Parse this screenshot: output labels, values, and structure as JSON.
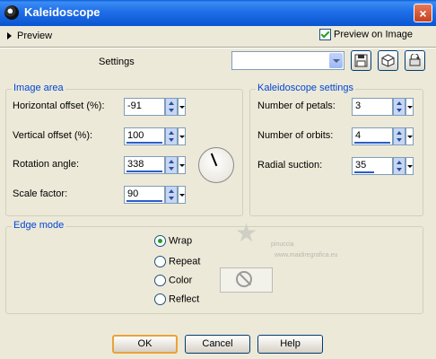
{
  "window": {
    "title": "Kaleidoscope",
    "close_glyph": "×"
  },
  "preview": {
    "label": "Preview",
    "preview_on_image_label": "Preview on Image",
    "preview_on_image_checked": true
  },
  "settings": {
    "label": "Settings",
    "select_value": ""
  },
  "toolbar_icons": [
    "save-icon",
    "random-cube-icon",
    "reset-icon"
  ],
  "image_area": {
    "legend": "Image area",
    "fields": [
      {
        "label": "Horizontal offset (%):",
        "value": "-91"
      },
      {
        "label": "Vertical offset (%):",
        "value": "100"
      },
      {
        "label": "Rotation angle:",
        "value": "338"
      },
      {
        "label": "Scale factor:",
        "value": "90"
      }
    ]
  },
  "kaleidoscope_settings": {
    "legend": "Kaleidoscope settings",
    "fields": [
      {
        "label": "Number of petals:",
        "value": "3"
      },
      {
        "label": "Number of orbits:",
        "value": "4"
      },
      {
        "label": "Radial suction:",
        "value": "35"
      }
    ]
  },
  "edge_mode": {
    "legend": "Edge mode",
    "options": [
      "Wrap",
      "Repeat",
      "Color",
      "Reflect"
    ],
    "selected": "Wrap"
  },
  "watermark": {
    "line1": "pinuccia",
    "line2": "www.maidiregrafica.eu"
  },
  "buttons": {
    "ok": "OK",
    "cancel": "Cancel",
    "help": "Help"
  }
}
